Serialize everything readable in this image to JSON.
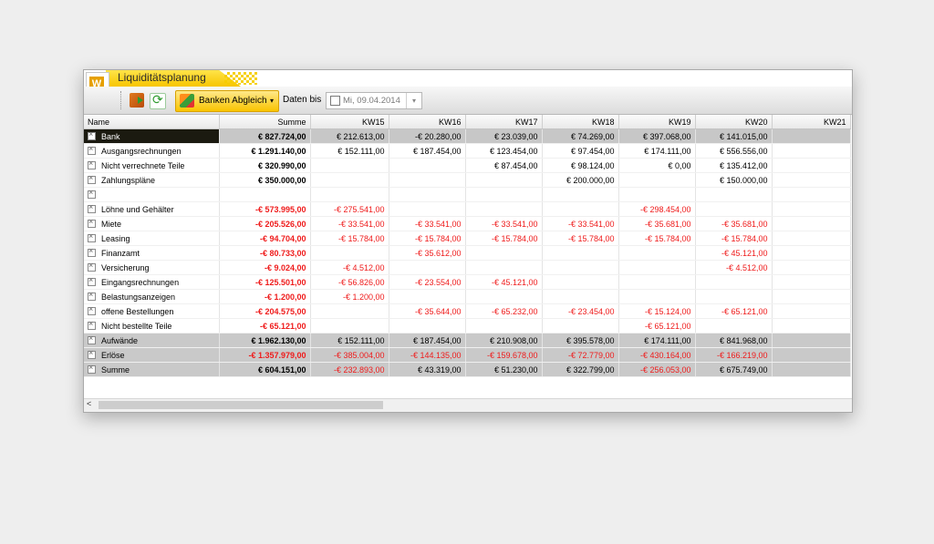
{
  "window": {
    "title": "Liquiditätsplanung"
  },
  "toolbar": {
    "exit_icon": "exit-icon",
    "refresh_icon": "refresh-icon",
    "banken_label": "Banken Abgleich",
    "daten_bis_label": "Daten bis",
    "date_value": "Mi, 09.04.2014"
  },
  "grid": {
    "columns": [
      "Name",
      "Summe",
      "KW15",
      "KW16",
      "KW17",
      "KW18",
      "KW19",
      "KW20",
      "KW21"
    ],
    "rows": [
      {
        "name": "Bank",
        "style": "dark",
        "cells": [
          "€ 827.724,00",
          "€ 212.613,00",
          "-€ 20.280,00",
          "€ 23.039,00",
          "€ 74.269,00",
          "€ 397.068,00",
          "€ 141.015,00",
          ""
        ]
      },
      {
        "name": "Ausgangsrechnungen",
        "style": "",
        "cells": [
          "€ 1.291.140,00",
          "€ 152.111,00",
          "€ 187.454,00",
          "€ 123.454,00",
          "€ 97.454,00",
          "€ 174.111,00",
          "€ 556.556,00",
          ""
        ]
      },
      {
        "name": "Nicht verrechnete Teile",
        "style": "",
        "cells": [
          "€ 320.990,00",
          "",
          "",
          "€ 87.454,00",
          "€ 98.124,00",
          "€ 0,00",
          "€ 135.412,00",
          ""
        ]
      },
      {
        "name": "Zahlungspläne",
        "style": "",
        "cells": [
          "€ 350.000,00",
          "",
          "",
          "",
          "€ 200.000,00",
          "",
          "€ 150.000,00",
          ""
        ]
      },
      {
        "name": "",
        "style": "",
        "cells": [
          "",
          "",
          "",
          "",
          "",
          "",
          "",
          ""
        ]
      },
      {
        "name": "Löhne und Gehälter",
        "style": "",
        "cells": [
          "-€ 573.995,00",
          "-€ 275.541,00",
          "",
          "",
          "",
          "-€ 298.454,00",
          "",
          ""
        ]
      },
      {
        "name": "Miete",
        "style": "",
        "cells": [
          "-€ 205.526,00",
          "-€ 33.541,00",
          "-€ 33.541,00",
          "-€ 33.541,00",
          "-€ 33.541,00",
          "-€ 35.681,00",
          "-€ 35.681,00",
          ""
        ]
      },
      {
        "name": "Leasing",
        "style": "",
        "cells": [
          "-€ 94.704,00",
          "-€ 15.784,00",
          "-€ 15.784,00",
          "-€ 15.784,00",
          "-€ 15.784,00",
          "-€ 15.784,00",
          "-€ 15.784,00",
          ""
        ]
      },
      {
        "name": "Finanzamt",
        "style": "",
        "cells": [
          "-€ 80.733,00",
          "",
          "-€ 35.612,00",
          "",
          "",
          "",
          "-€ 45.121,00",
          ""
        ]
      },
      {
        "name": "Versicherung",
        "style": "",
        "cells": [
          "-€ 9.024,00",
          "-€ 4.512,00",
          "",
          "",
          "",
          "",
          "-€ 4.512,00",
          ""
        ]
      },
      {
        "name": "Eingangsrechnungen",
        "style": "",
        "cells": [
          "-€ 125.501,00",
          "-€ 56.826,00",
          "-€ 23.554,00",
          "-€ 45.121,00",
          "",
          "",
          "",
          ""
        ]
      },
      {
        "name": "Belastungsanzeigen",
        "style": "",
        "cells": [
          "-€ 1.200,00",
          "-€ 1.200,00",
          "",
          "",
          "",
          "",
          "",
          ""
        ]
      },
      {
        "name": "offene Bestellungen",
        "style": "",
        "cells": [
          "-€ 204.575,00",
          "",
          "-€ 35.644,00",
          "-€ 65.232,00",
          "-€ 23.454,00",
          "-€ 15.124,00",
          "-€ 65.121,00",
          ""
        ]
      },
      {
        "name": "Nicht bestellte Teile",
        "style": "",
        "cells": [
          "-€ 65.121,00",
          "",
          "",
          "",
          "",
          "-€ 65.121,00",
          "",
          ""
        ]
      },
      {
        "name": "Aufwände",
        "style": "gray",
        "cells": [
          "€ 1.962.130,00",
          "€ 152.111,00",
          "€ 187.454,00",
          "€ 210.908,00",
          "€ 395.578,00",
          "€ 174.111,00",
          "€ 841.968,00",
          ""
        ]
      },
      {
        "name": "Erlöse",
        "style": "gray",
        "cells": [
          "-€ 1.357.979,00",
          "-€ 385.004,00",
          "-€ 144.135,00",
          "-€ 159.678,00",
          "-€ 72.779,00",
          "-€ 430.164,00",
          "-€ 166.219,00",
          ""
        ]
      },
      {
        "name": "Summe",
        "style": "gray",
        "cells": [
          "€ 604.151,00",
          "-€ 232.893,00",
          "€ 43.319,00",
          "€ 51.230,00",
          "€ 322.799,00",
          "-€ 256.053,00",
          "€ 675.749,00",
          ""
        ]
      }
    ]
  },
  "scrollbar": {
    "arrow": "<"
  },
  "colors": {
    "negative": "#ef1b1b",
    "accent": "#f9c400"
  }
}
